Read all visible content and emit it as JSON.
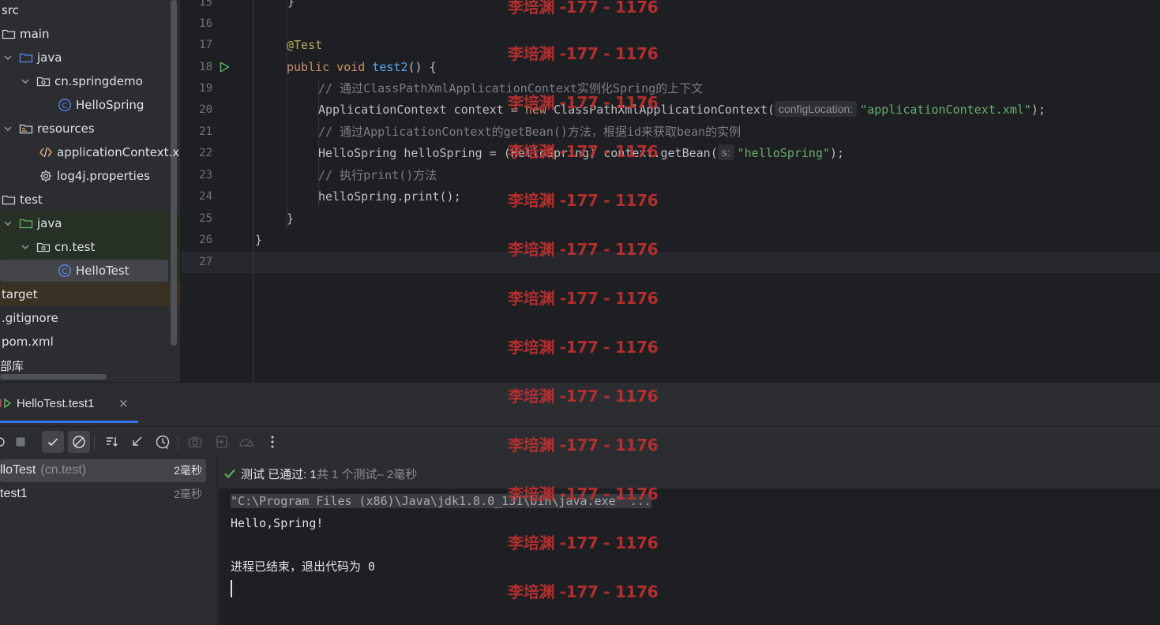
{
  "project_tree": {
    "items": [
      {
        "label": "src",
        "icon": "none"
      },
      {
        "label": "main",
        "icon": "folder-icon"
      },
      {
        "label": "java",
        "icon": "source-folder-icon"
      },
      {
        "label": "cn.springdemo",
        "icon": "package-icon"
      },
      {
        "label": "HelloSpring",
        "icon": "class-icon"
      },
      {
        "label": "resources",
        "icon": "resources-folder-icon"
      },
      {
        "label": "applicationContext.x",
        "icon": "xml-file-icon"
      },
      {
        "label": "log4j.properties",
        "icon": "properties-file-icon"
      },
      {
        "label": "test",
        "icon": "folder-icon"
      },
      {
        "label": "java",
        "icon": "test-source-folder-icon"
      },
      {
        "label": "cn.test",
        "icon": "package-icon"
      },
      {
        "label": "HelloTest",
        "icon": "class-icon"
      },
      {
        "label": "target",
        "icon": "none"
      },
      {
        "label": ".gitignore",
        "icon": "none"
      },
      {
        "label": "pom.xml",
        "icon": "none"
      },
      {
        "label": "部库",
        "icon": "none"
      }
    ]
  },
  "editor": {
    "line_numbers": [
      "15",
      "16",
      "17",
      "18",
      "19",
      "20",
      "21",
      "22",
      "23",
      "24",
      "25",
      "26",
      "27"
    ],
    "code": {
      "l15": "}",
      "l17_ann": "@Test",
      "l18_kw": "public void ",
      "l18_fn": "test2",
      "l18_rest": "() {",
      "l19": "// 通过ClassPathXmlApplicationContext实例化Spring的上下文",
      "l20_a": "ApplicationContext context = ",
      "l20_kw": "new",
      "l20_b": " ClassPathXmlApplicationContext(",
      "l20_hint": "configLocation:",
      "l20_str": "\"applicationContext.xml\"",
      "l20_end": ");",
      "l21": "// 通过ApplicationContext的getBean()方法，根据id来获取bean的实例",
      "l22_a": "HelloSpring helloSpring = (HelloSpring) context.getBean(",
      "l22_hint": "s:",
      "l22_str": "\"helloSpring\"",
      "l22_end": ");",
      "l23": "// 执行print()方法",
      "l24": "helloSpring.print();",
      "l25": "}",
      "l26": "}"
    }
  },
  "run_panel": {
    "tab_label": "HelloTest.test1",
    "tab_close": "×",
    "tests": [
      {
        "name": "lloTest",
        "package": "(cn.test)",
        "time": "2毫秒"
      },
      {
        "name": "test1",
        "package": "",
        "time": "2毫秒"
      }
    ],
    "status": {
      "part1": "测试 已通过: 1",
      "part2": "共 1 个测试",
      "part3": " – 2毫秒"
    },
    "console": {
      "cmd": "\"C:\\Program Files (x86)\\Java\\jdk1.8.0_131\\bin\\java.exe\" ...",
      "out1": "Hello,Spring!",
      "out2": "进程已结束，退出代码为 0"
    }
  },
  "watermark": "李培渊 -177 - 1176",
  "colors": {
    "accent": "#3574f0",
    "pass_green": "#5fb865",
    "watermark_red": "#c03030"
  }
}
